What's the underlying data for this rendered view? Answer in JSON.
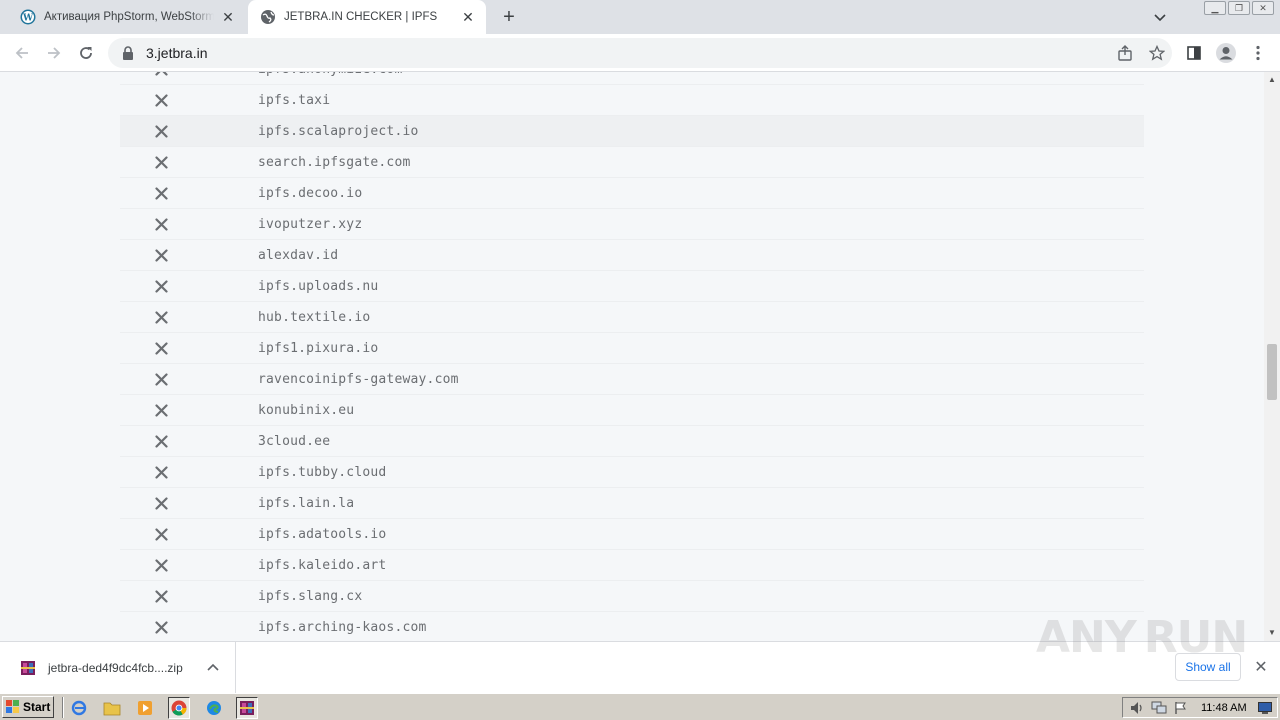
{
  "tabs": [
    {
      "title": "Активация PhpStorm, WebStorm, IntelliJ IDEA",
      "favicon": "wordpress-icon",
      "active": false
    },
    {
      "title": "JETBRA.IN CHECKER | IPFS",
      "favicon": "globe-icon",
      "active": true
    }
  ],
  "toolbar": {
    "url": "3.jetbra.in"
  },
  "gateways": [
    {
      "host": "ipfs.anonymize.com",
      "status": "fail"
    },
    {
      "host": "ipfs.taxi",
      "status": "fail"
    },
    {
      "host": "ipfs.scalaproject.io",
      "status": "fail"
    },
    {
      "host": "search.ipfsgate.com",
      "status": "fail"
    },
    {
      "host": "ipfs.decoo.io",
      "status": "fail"
    },
    {
      "host": "ivoputzer.xyz",
      "status": "fail"
    },
    {
      "host": "alexdav.id",
      "status": "fail"
    },
    {
      "host": "ipfs.uploads.nu",
      "status": "fail"
    },
    {
      "host": "hub.textile.io",
      "status": "fail"
    },
    {
      "host": "ipfs1.pixura.io",
      "status": "fail"
    },
    {
      "host": "ravencoinipfs-gateway.com",
      "status": "fail"
    },
    {
      "host": "konubinix.eu",
      "status": "fail"
    },
    {
      "host": "3cloud.ee",
      "status": "fail"
    },
    {
      "host": "ipfs.tubby.cloud",
      "status": "fail"
    },
    {
      "host": "ipfs.lain.la",
      "status": "fail"
    },
    {
      "host": "ipfs.adatools.io",
      "status": "fail"
    },
    {
      "host": "ipfs.kaleido.art",
      "status": "fail"
    },
    {
      "host": "ipfs.slang.cx",
      "status": "fail"
    },
    {
      "host": "ipfs.arching-kaos.com",
      "status": "fail"
    }
  ],
  "highlighted_row": 2,
  "download": {
    "filename": "jetbra-ded4f9dc4fcb....zip",
    "show_all": "Show all"
  },
  "watermark": "ANY RUN",
  "taskbar": {
    "start": "Start",
    "clock": "11:48 AM"
  },
  "colors": {
    "fail_icon": "#6b6e72",
    "content_bg": "#f5f7f9",
    "link_blue": "#1a73e8"
  }
}
